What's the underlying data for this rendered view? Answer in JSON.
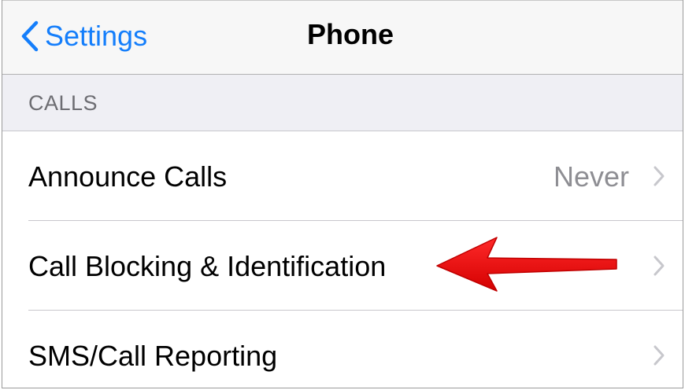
{
  "navbar": {
    "back_label": "Settings",
    "title": "Phone"
  },
  "section": {
    "header": "CALLS"
  },
  "rows": [
    {
      "label": "Announce Calls",
      "value": "Never"
    },
    {
      "label": "Call Blocking & Identification",
      "value": ""
    },
    {
      "label": "SMS/Call Reporting",
      "value": ""
    }
  ],
  "annotation": {
    "type": "red-arrow-icon",
    "color": "#f01010",
    "points_to": "Call Blocking & Identification"
  },
  "colors": {
    "accent": "#147efb",
    "secondary_text": "#8e8e93",
    "group_background": "#efeff4"
  }
}
